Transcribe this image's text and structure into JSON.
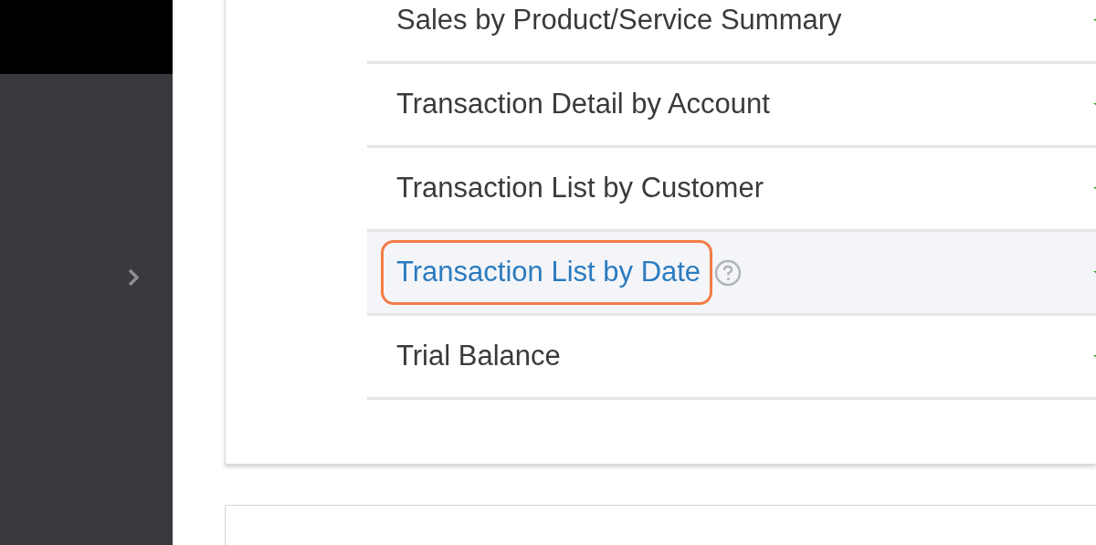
{
  "reports": [
    {
      "label": "Sales by Product/Service Summary",
      "selected": false,
      "highlighted": false,
      "help": false
    },
    {
      "label": "Transaction Detail by Account",
      "selected": false,
      "highlighted": false,
      "help": false
    },
    {
      "label": "Transaction List by Customer",
      "selected": false,
      "highlighted": false,
      "help": false
    },
    {
      "label": "Transaction List by Date",
      "selected": true,
      "highlighted": true,
      "help": true
    },
    {
      "label": "Trial Balance",
      "selected": false,
      "highlighted": false,
      "help": false
    }
  ]
}
